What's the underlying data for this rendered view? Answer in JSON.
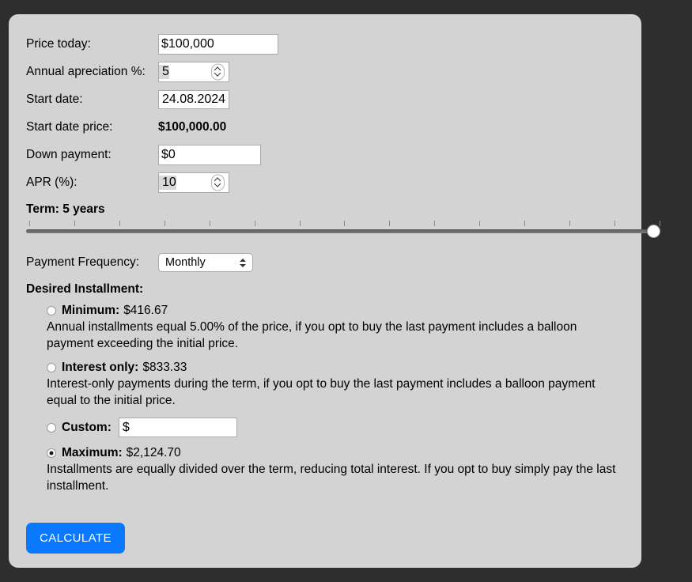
{
  "theme": {
    "page_background": "#2e2e2e",
    "panel_background": "#d3d3d3",
    "accent": "#0a78ff"
  },
  "form": {
    "price_today": {
      "label": "Price today:",
      "value": "$100,000"
    },
    "annual_appreciation": {
      "label": "Annual apreciation %:",
      "value": "5"
    },
    "start_date": {
      "label": "Start date:",
      "value": "24.08.2024"
    },
    "start_date_price": {
      "label": "Start date price:",
      "value": "$100,000.00"
    },
    "down_payment": {
      "label": "Down payment:",
      "value": "$0"
    },
    "apr": {
      "label": "APR (%):",
      "value": "10"
    }
  },
  "term": {
    "label": "Term: 5 years",
    "value": 5,
    "min": 1,
    "max": 30,
    "tick_count": 15,
    "thumb_position_percent": 100
  },
  "payment_frequency": {
    "label": "Payment Frequency:",
    "selected": "Monthly",
    "options": [
      "Monthly"
    ]
  },
  "desired_installment": {
    "title": "Desired Installment:",
    "selected": "maximum",
    "options": [
      {
        "id": "minimum",
        "name": "Minimum:",
        "amount": "$416.67",
        "selected": false,
        "description": "Annual installments equal 5.00% of the price, if you opt to buy the last payment includes a balloon payment exceeding the initial price."
      },
      {
        "id": "interest_only",
        "name": "Interest only:",
        "amount": "$833.33",
        "selected": false,
        "description": "Interest-only payments during the term, if you opt to buy the last payment includes a balloon payment equal to the initial price."
      },
      {
        "id": "custom",
        "name": "Custom:",
        "amount": "",
        "selected": false,
        "input_value": "$",
        "description": ""
      },
      {
        "id": "maximum",
        "name": "Maximum:",
        "amount": "$2,124.70",
        "selected": true,
        "description": "Installments are equally divided over the term, reducing total interest. If you opt to buy simply pay the last installment."
      }
    ]
  },
  "actions": {
    "calculate_label": "CALCULATE"
  }
}
